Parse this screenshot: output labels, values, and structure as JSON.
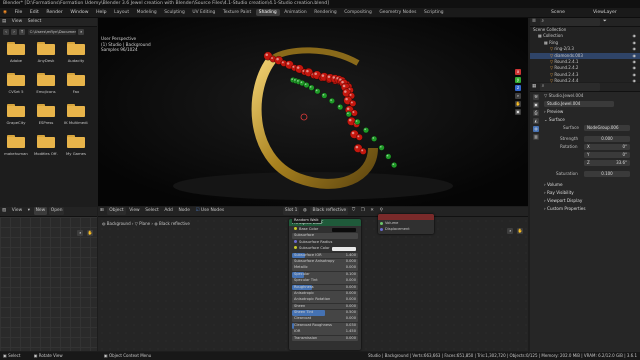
{
  "window_title": "Blender* [D:\\Formations\\Formation Udemy\\Blender 3.6 Jewel creation with Blender\\Source Files\\4.1-Studio creation\\4.1-Studio creation.blend]",
  "menu": [
    "File",
    "Edit",
    "Render",
    "Window",
    "Help"
  ],
  "workspace_tabs": [
    "Layout",
    "Modeling",
    "Sculpting",
    "UV Editing",
    "Texture Paint",
    "Shading",
    "Animation",
    "Rendering",
    "Compositing",
    "Geometry Nodes",
    "Scripting"
  ],
  "active_workspace": "Shading",
  "scene_label": "Scene",
  "view_layer_label": "ViewLayer",
  "file_browser": {
    "view": "View",
    "select": "Select",
    "path": "C:\\Users\\mflyn\\Documents\\...",
    "folders": [
      "Adobe",
      "AnyDesk",
      "Audacity",
      "CVSet 5",
      "Emojicons",
      "Fax",
      "GrapeCity",
      "ESPress",
      "IK Multimedia",
      "makehuman",
      "Modèles Off...",
      "My Games"
    ]
  },
  "viewport": {
    "mode": "Object Mode",
    "view": "View",
    "select": "Select",
    "add": "Add",
    "object": "Object",
    "orientation": "Global",
    "options": "Options",
    "info_line1": "User Perspective",
    "info_line2": "(1) Studio | Background",
    "info_line3": "Samples 96/1024"
  },
  "outliner": {
    "header": "Scene Collection",
    "items": [
      {
        "label": "Collection",
        "depth": 0
      },
      {
        "label": "Ring",
        "depth": 1
      },
      {
        "label": "ring-2/3.3",
        "depth": 2
      },
      {
        "label": "diamonds.003",
        "depth": 2
      },
      {
        "label": "Round.2.4.1",
        "depth": 2
      },
      {
        "label": "Round.2.4.2",
        "depth": 2
      },
      {
        "label": "Round.2.4.3",
        "depth": 2
      },
      {
        "label": "Round.2.4.4",
        "depth": 2
      },
      {
        "label": "Round.2.4.5",
        "depth": 2
      }
    ]
  },
  "properties": {
    "object": "Studio.Jewel.004",
    "material_slot": "Studio.Jewel.004",
    "sections": {
      "preview": "Preview",
      "surface": "Surface",
      "volume": "Volume",
      "ray_visibility": "Ray Visibility",
      "viewport_display": "Viewport Display",
      "custom_properties": "Custom Properties"
    },
    "surface_label": "Surface",
    "surface_value": "NodeGroup.006",
    "strength_label": "Strength",
    "strength_value": "0.000",
    "rotation_label": "Rotation",
    "rot_x_label": "X",
    "rot_x": "0°",
    "rot_y_label": "Y",
    "rot_y": "0°",
    "rot_z_label": "Z",
    "rot_z": "33.6°",
    "saturation_label": "Saturation",
    "saturation_value": "0.100"
  },
  "image_editor": {
    "view": "View",
    "new": "New",
    "open": "Open"
  },
  "shader_editor": {
    "object": "Object",
    "view": "View",
    "select": "Select",
    "add": "Add",
    "node": "Node",
    "use_nodes": "Use Nodes",
    "slot": "Slot 1",
    "material": "Black reflective",
    "breadcrumb": [
      "Background",
      "Plane",
      "Black reflective"
    ],
    "tooltip": "Random Walk",
    "bsdf_title": "Principled BSDF",
    "bsdf_rows": [
      {
        "label": "Base Color",
        "type": "color"
      },
      {
        "label": "Subsurface",
        "fill": 0,
        "value": ""
      },
      {
        "label": "Subsurface Radius",
        "type": "vector"
      },
      {
        "label": "Subsurface Color",
        "type": "color2"
      },
      {
        "label": "Subsurface IOR",
        "fill": 0.2,
        "value": "1.400"
      },
      {
        "label": "Subsurface Anisotropy",
        "fill": 0,
        "value": "0.000"
      },
      {
        "label": "Metallic",
        "fill": 0,
        "value": "0.000"
      },
      {
        "label": "Specular",
        "fill": 0.18,
        "value": "0.100"
      },
      {
        "label": "Specular Tint",
        "fill": 0,
        "value": "0.000"
      },
      {
        "label": "Roughness",
        "fill": 0.3,
        "value": "0.000"
      },
      {
        "label": "Anisotropic",
        "fill": 0,
        "value": "0.000"
      },
      {
        "label": "Anisotropic Rotation",
        "fill": 0,
        "value": "0.000"
      },
      {
        "label": "Sheen",
        "fill": 0,
        "value": "0.000"
      },
      {
        "label": "Sheen Tint",
        "fill": 0.5,
        "value": "0.500"
      },
      {
        "label": "Clearcoat",
        "fill": 0,
        "value": "0.000"
      },
      {
        "label": "Clearcoat Roughness",
        "fill": 0.03,
        "value": "0.030"
      },
      {
        "label": "IOR",
        "fill": 0,
        "value": "1.450"
      },
      {
        "label": "Transmission",
        "fill": 0,
        "value": "0.000"
      }
    ],
    "mat_output": {
      "volume": "Volume",
      "displacement": "Displacement"
    }
  },
  "status": {
    "select": "Select",
    "rotate": "Rotate View",
    "context": "Object Context Menu",
    "right": "Studio | Background | Verts:663,663 | Faces:651,850 | Tris:1,302,720 | Objects:0/125 | Memory: 202.0 MiB | VRAM: 6.2/12.0 GiB | 3.6.1"
  },
  "colors": {
    "accent": "#4772b3",
    "folder": "#e8b44a",
    "gold": "#b8922e",
    "ruby": "#c4170e",
    "emerald": "#1f9a27"
  }
}
